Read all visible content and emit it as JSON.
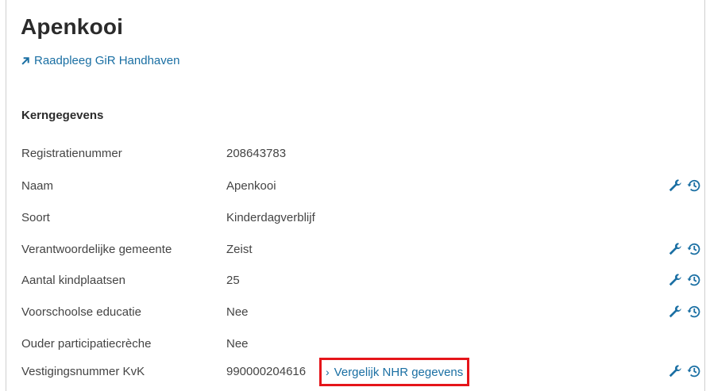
{
  "header": {
    "title": "Apenkooi",
    "external_link_label": "Raadpleeg GiR Handhaven"
  },
  "section": {
    "heading": "Kerngegevens"
  },
  "rows": [
    {
      "label": "Registratienummer",
      "value": "208643783",
      "editable": false
    },
    {
      "label": "Naam",
      "value": "Apenkooi",
      "editable": true
    },
    {
      "label": "Soort",
      "value": "Kinderdagverblijf",
      "editable": false
    },
    {
      "label": "Verantwoordelijke gemeente",
      "value": "Zeist",
      "editable": true
    },
    {
      "label": "Aantal kindplaatsen",
      "value": "25",
      "editable": true
    },
    {
      "label": "Voorschoolse educatie",
      "value": "Nee",
      "editable": true
    },
    {
      "label": "Ouder participatiecrèche",
      "value": "Nee",
      "editable": false
    },
    {
      "label": "Vestigingsnummer KvK",
      "value": "990000204616",
      "editable": true
    }
  ],
  "compare_link": {
    "label": "Vergelijk NHR gegevens"
  },
  "icons": {
    "edit": "wrench-icon",
    "history": "history-icon",
    "external": "external-arrow-icon"
  },
  "colors": {
    "link": "#1a6fa3",
    "icon": "#1a6fa3",
    "highlight_border": "#e5151a"
  }
}
